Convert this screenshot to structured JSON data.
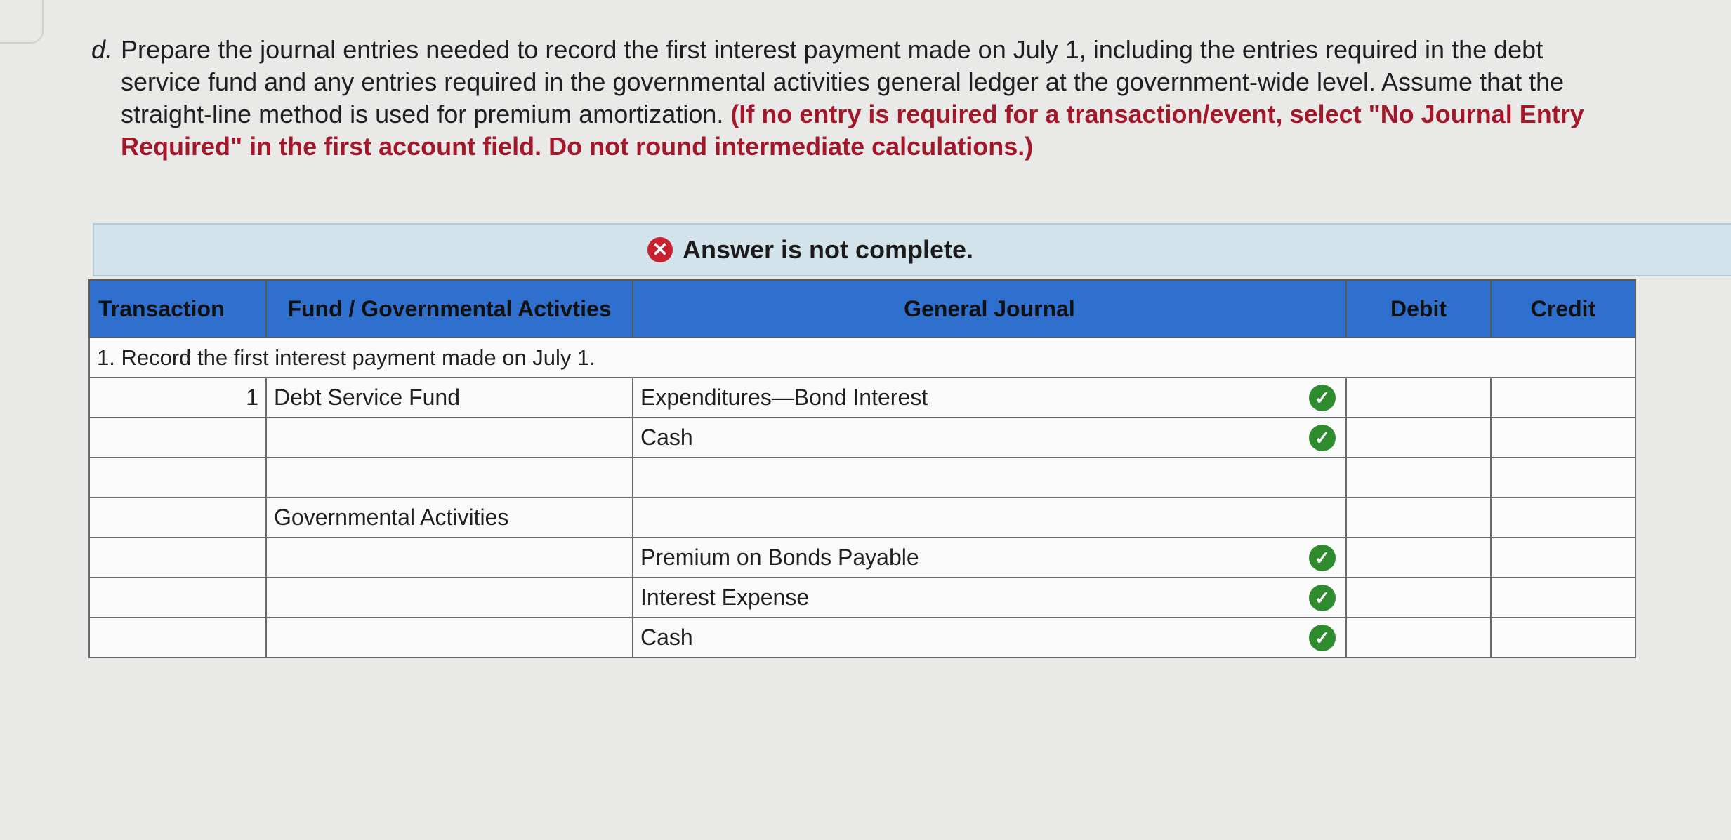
{
  "question": {
    "letter": "d.",
    "text": "Prepare the journal entries needed to record the first interest payment made on July 1, including the entries required in the debt service fund and any entries required in the governmental activities general ledger at the government-wide level. Assume that the straight-line method is used for premium amortization.",
    "instruction": "(If no entry is required for a transaction/event, select \"No Journal Entry Required\" in the first account field. Do not round intermediate calculations.)"
  },
  "banner": {
    "icon": "x-circle-icon",
    "text": "Answer is not complete."
  },
  "table": {
    "headers": {
      "transaction": "Transaction",
      "fund": "Fund / Governmental Activties",
      "journal": "General Journal",
      "debit": "Debit",
      "credit": "Credit"
    },
    "section_label": "1. Record the first interest payment made on July 1.",
    "rows": [
      {
        "transaction": "1",
        "fund": "Debt Service Fund",
        "account": "Expenditures—Bond Interest",
        "check": true,
        "debit": "",
        "credit": ""
      },
      {
        "transaction": "",
        "fund": "",
        "account": "Cash",
        "check": true,
        "debit": "",
        "credit": ""
      },
      {
        "transaction": "",
        "fund": "",
        "account": "",
        "check": false,
        "debit": "",
        "credit": ""
      },
      {
        "transaction": "",
        "fund": "Governmental Activities",
        "account": "",
        "check": false,
        "debit": "",
        "credit": ""
      },
      {
        "transaction": "",
        "fund": "",
        "account": "Premium on Bonds Payable",
        "check": true,
        "debit": "",
        "credit": ""
      },
      {
        "transaction": "",
        "fund": "",
        "account": "Interest Expense",
        "check": true,
        "debit": "",
        "credit": ""
      },
      {
        "transaction": "",
        "fund": "",
        "account": "Cash",
        "check": true,
        "debit": "",
        "credit": ""
      }
    ]
  },
  "colors": {
    "header_bg": "#2f6fce",
    "banner_bg": "#d3e3ec",
    "instruction_red": "#a3172b",
    "check_green": "#2e8b2e",
    "error_red": "#c8202f"
  }
}
